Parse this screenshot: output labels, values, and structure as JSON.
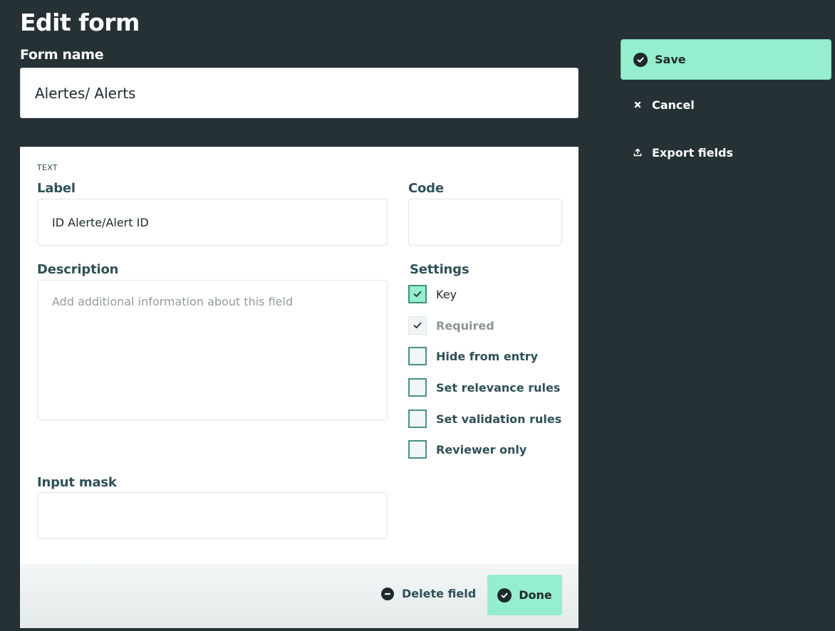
{
  "header": {
    "title": "Edit form",
    "form_name_label": "Form name",
    "form_name_value": "Alertes/ Alerts"
  },
  "actions": {
    "save": "Save",
    "cancel": "Cancel",
    "export": "Export fields"
  },
  "field": {
    "type": "TEXT",
    "label_label": "Label",
    "label_value": "ID Alerte/Alert ID",
    "code_label": "Code",
    "code_value": "",
    "description_label": "Description",
    "description_placeholder": "Add additional information about this field",
    "description_value": "",
    "input_mask_label": "Input mask",
    "input_mask_value": "",
    "settings_label": "Settings",
    "settings": [
      {
        "label": "Key",
        "checked": true,
        "disabled": false
      },
      {
        "label": "Required",
        "checked": true,
        "disabled": true
      },
      {
        "label": "Hide from entry",
        "checked": false,
        "disabled": false
      },
      {
        "label": "Set relevance rules",
        "checked": false,
        "disabled": false
      },
      {
        "label": "Set validation rules",
        "checked": false,
        "disabled": false
      },
      {
        "label": "Reviewer only",
        "checked": false,
        "disabled": false
      }
    ],
    "delete_label": "Delete field",
    "done_label": "Done"
  },
  "colors": {
    "background": "#253134",
    "accent": "#95eecd",
    "label_text": "#2f5157"
  },
  "icons": {
    "save": "check-circle-icon",
    "cancel": "close-icon",
    "export": "upload-icon",
    "delete": "minus-circle-icon",
    "done": "check-circle-icon"
  }
}
